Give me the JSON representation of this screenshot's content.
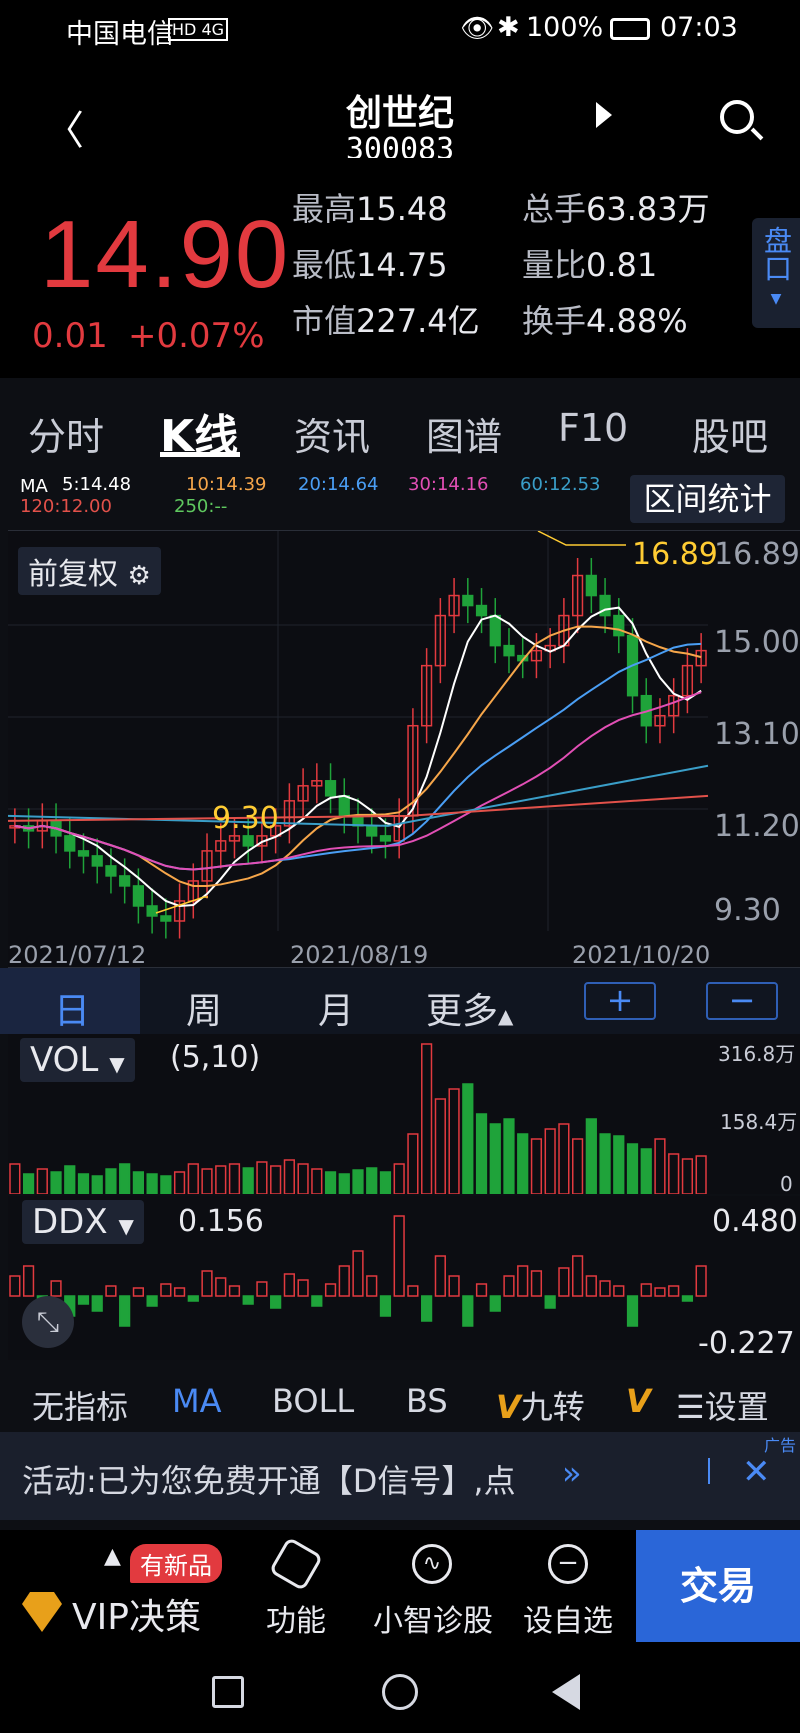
{
  "status": {
    "carrier": "中国电信",
    "network": "HD 4G",
    "battery": "100%",
    "time": "07:03"
  },
  "header": {
    "name": "创世纪",
    "code": "300083"
  },
  "quote": {
    "price": "14.90",
    "change": "0.01",
    "change_pct": "+0.07%",
    "high_k": "最高",
    "high_v": "15.48",
    "low_k": "最低",
    "low_v": "14.75",
    "mcap_k": "市值",
    "mcap_v": "227.4亿",
    "vol_k": "总手",
    "vol_v": "63.83万",
    "ratio_k": "量比",
    "ratio_v": "0.81",
    "turn_k": "换手",
    "turn_v": "4.88%",
    "pankou": "盘口"
  },
  "tabs": [
    "分时",
    "K线",
    "资讯",
    "图谱",
    "F10",
    "股吧"
  ],
  "ma": {
    "label": "MA",
    "ma5": "5:14.48",
    "ma10": "10:14.39",
    "ma20": "20:14.64",
    "ma30": "30:14.16",
    "ma60": "60:12.53",
    "ma120": "120:12.00",
    "ma250": "250:--"
  },
  "range_btn": "区间统计",
  "chart": {
    "adjust": "前复权",
    "high_mark": "16.89",
    "low_mark": "9.30",
    "y_ticks": [
      "16.89",
      "15.00",
      "13.10",
      "11.20",
      "9.30"
    ],
    "dates": [
      "2021/07/12",
      "2021/08/19",
      "2021/10/20"
    ]
  },
  "periods": {
    "day": "日",
    "week": "周",
    "month": "月",
    "more": "更多",
    "plus": "+",
    "minus": "−"
  },
  "vol": {
    "label": "VOL",
    "params": "(5,10)",
    "top": "316.8万",
    "mid": "158.4万",
    "zero": "0"
  },
  "ddx": {
    "label": "DDX",
    "value": "0.156",
    "top": "0.480",
    "bottom": "-0.227"
  },
  "indicators": [
    "无指标",
    "MA",
    "BOLL",
    "BS",
    "九转",
    "设置"
  ],
  "ad": {
    "text": "活动:已为您免费开通【D信号】,点",
    "tag": "广告"
  },
  "bottom": {
    "new_badge": "有新品",
    "vip": "VIP决策",
    "func": "功能",
    "diag": "小智诊股",
    "watch": "设自选",
    "trade": "交易"
  },
  "colors": {
    "up": "#e23a3f",
    "down": "#1fa33a",
    "accent": "#4a8af4",
    "ma5": "#ffffff",
    "ma10": "#f6a64a",
    "ma20": "#4a9ef4",
    "ma30": "#e24fb5",
    "ma60": "#3a9ec8",
    "ma120": "#e2514a"
  }
}
